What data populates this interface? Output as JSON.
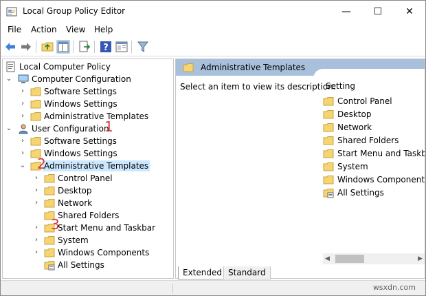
{
  "window": {
    "title": "Local Group Policy Editor",
    "minimize_glyph": "—",
    "maximize_glyph": "☐",
    "close_glyph": "✕"
  },
  "menu": {
    "items": [
      "File",
      "Action",
      "View",
      "Help"
    ]
  },
  "toolbar": {
    "icons": [
      "back-arrow-icon",
      "forward-arrow-icon",
      "up-folder-icon",
      "show-hide-tree-icon",
      "export-list-icon",
      "help-icon",
      "properties-icon",
      "filter-icon"
    ]
  },
  "tree": {
    "root": "Local Computer Policy",
    "computer_config": "Computer Configuration",
    "cc_children": [
      "Software Settings",
      "Windows Settings",
      "Administrative Templates"
    ],
    "user_config": "User Configuration",
    "uc_children": [
      "Software Settings",
      "Windows Settings"
    ],
    "uc_admin": "Administrative Templates",
    "uc_admin_children": [
      "Control Panel",
      "Desktop",
      "Network",
      "Shared Folders",
      "Start Menu and Taskbar",
      "System",
      "Windows Components",
      "All Settings"
    ]
  },
  "right_pane": {
    "header": "Administrative Templates",
    "description": "Select an item to view its description.",
    "column_header": "Setting",
    "items": [
      "Control Panel",
      "Desktop",
      "Network",
      "Shared Folders",
      "Start Menu and Taskbar",
      "System",
      "Windows Components",
      "All Settings"
    ]
  },
  "bottom_tabs": [
    "Extended",
    "Standard"
  ],
  "markers": [
    "1",
    "2",
    "3"
  ],
  "watermark": "wsxdn.com",
  "colors": {
    "folder": "#f5d472",
    "header_bg": "#a9c0dc",
    "selection": "#cce8ff",
    "marker": "#d9383a",
    "back_arrow": "#3f7fd6"
  }
}
